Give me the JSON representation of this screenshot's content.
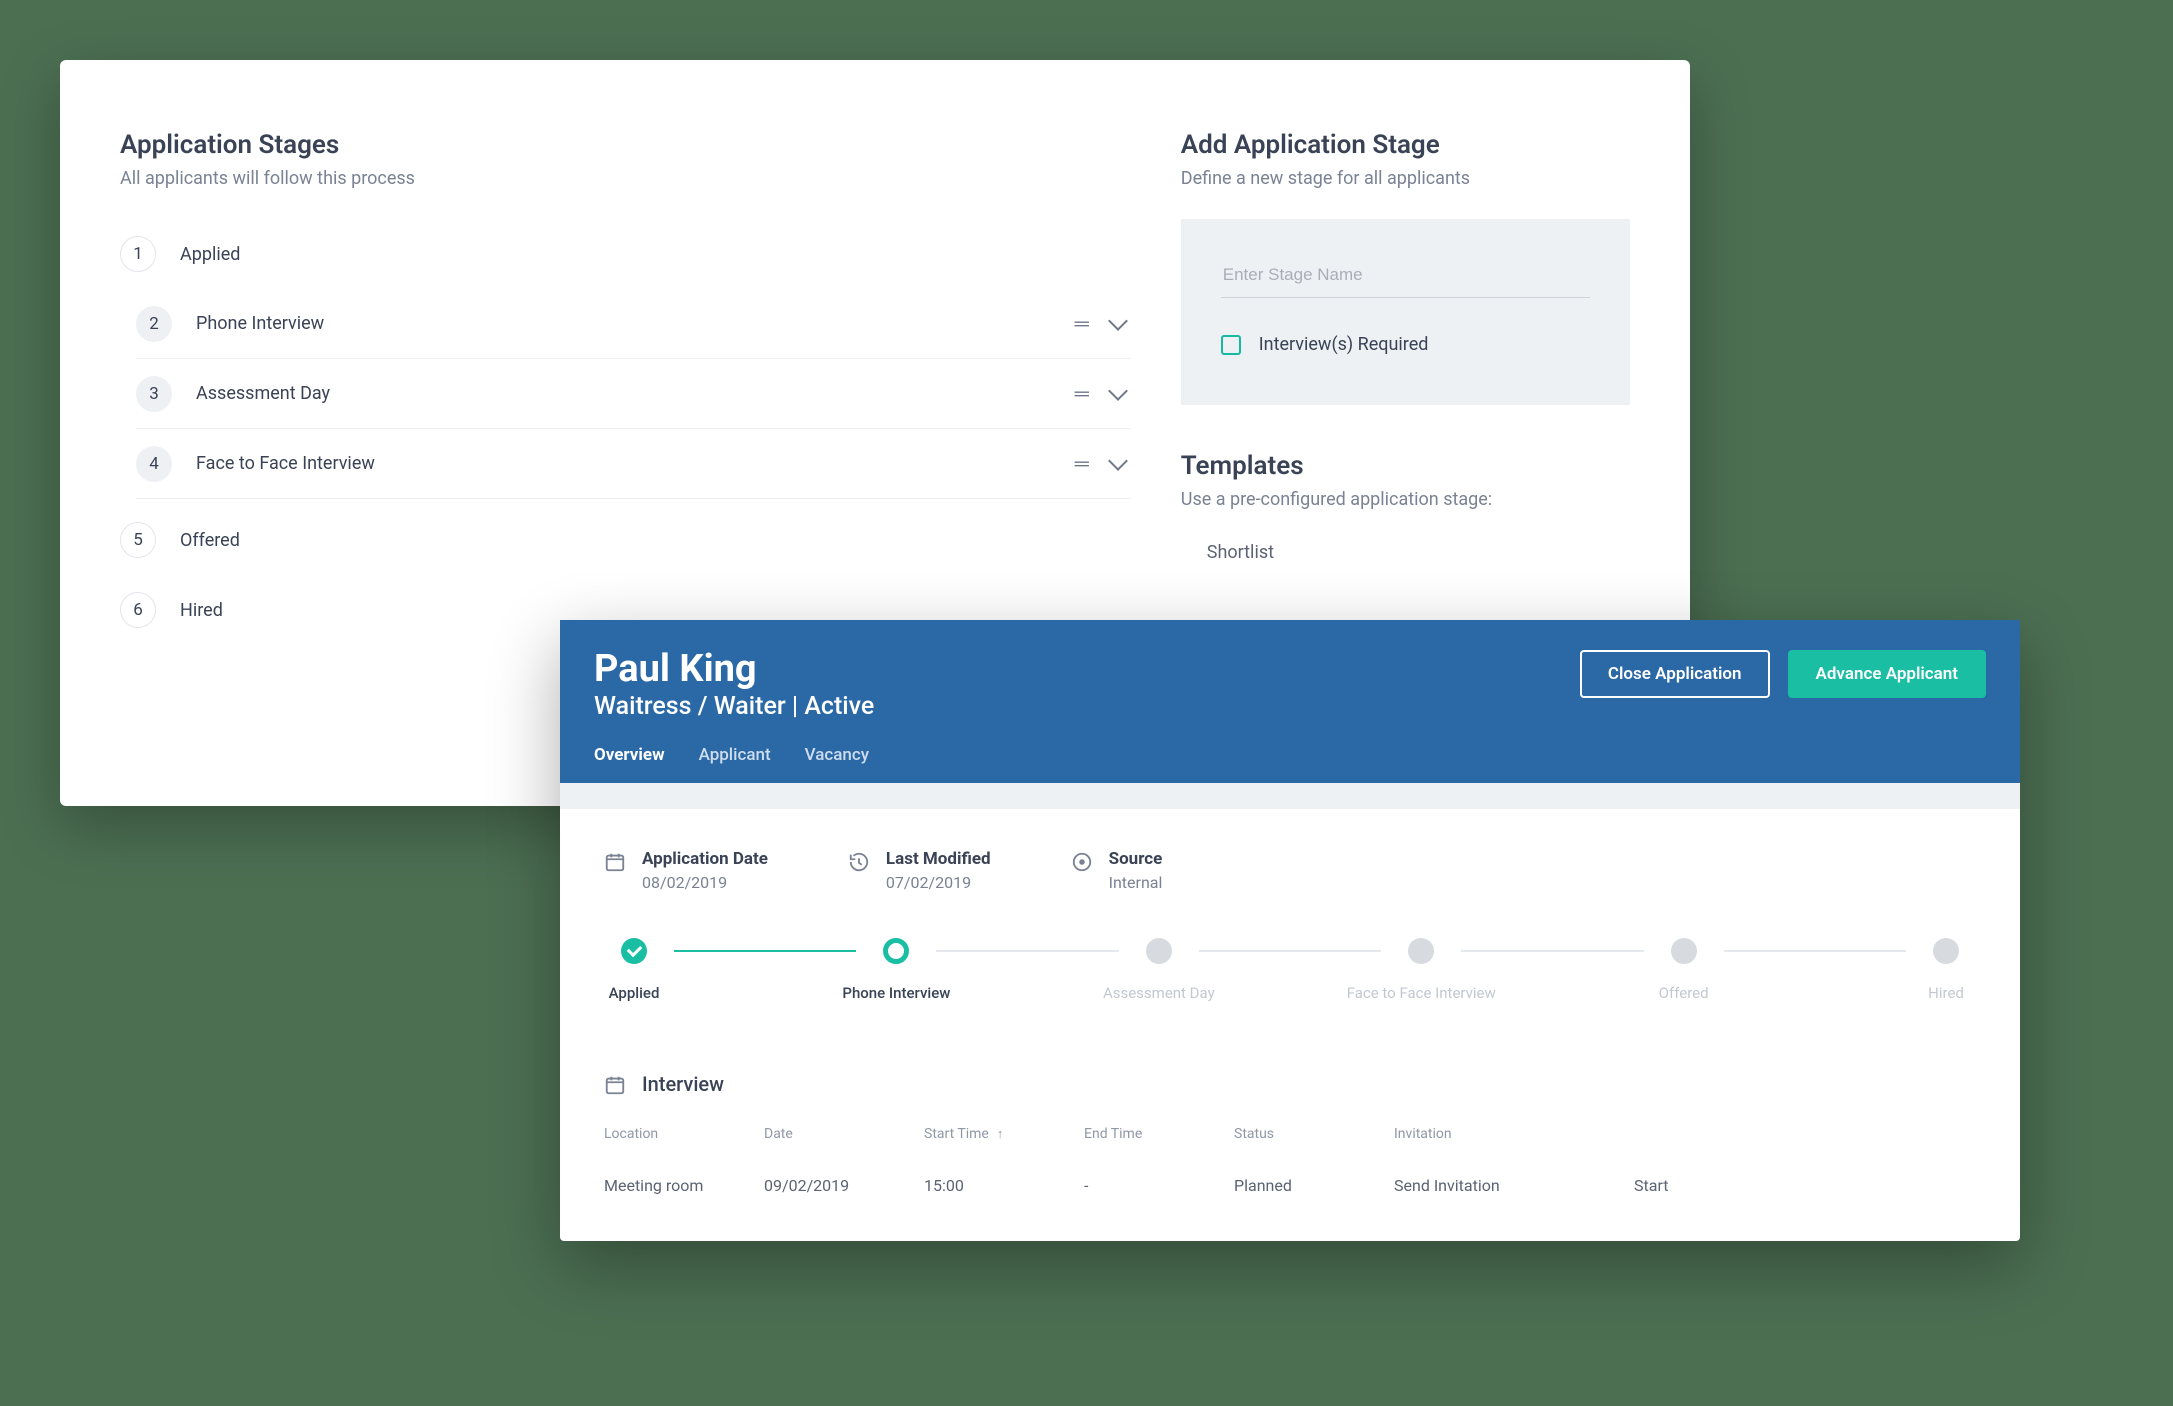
{
  "stagesPanel": {
    "title": "Application Stages",
    "subtitle": "All applicants will follow this process",
    "stages": [
      {
        "num": "1",
        "label": "Applied"
      },
      {
        "num": "2",
        "label": "Phone Interview"
      },
      {
        "num": "3",
        "label": "Assessment Day"
      },
      {
        "num": "4",
        "label": "Face to Face Interview"
      },
      {
        "num": "5",
        "label": "Offered"
      },
      {
        "num": "6",
        "label": "Hired"
      }
    ]
  },
  "addStage": {
    "title": "Add Application Stage",
    "subtitle": "Define a new stage for all applicants",
    "placeholder": "Enter Stage Name",
    "checkboxLabel": "Interview(s) Required"
  },
  "templates": {
    "title": "Templates",
    "subtitle": "Use a pre-configured application stage:",
    "items": [
      "Shortlist"
    ]
  },
  "applicant": {
    "name": "Paul King",
    "role_status": "Waitress / Waiter | Active",
    "closeBtn": "Close Application",
    "advanceBtn": "Advance Applicant",
    "tabs": {
      "overview": "Overview",
      "applicant": "Applicant",
      "vacancy": "Vacancy"
    },
    "meta": {
      "appDateLabel": "Application Date",
      "appDate": "08/02/2019",
      "modLabel": "Last Modified",
      "modDate": "07/02/2019",
      "sourceLabel": "Source",
      "source": "Internal"
    },
    "pipeline": [
      "Applied",
      "Phone Interview",
      "Assessment Day",
      "Face to Face Interview",
      "Offered",
      "Hired"
    ],
    "interview": {
      "title": "Interview",
      "headers": {
        "location": "Location",
        "date": "Date",
        "start": "Start Time",
        "end": "End Time",
        "status": "Status",
        "invitation": "Invitation"
      },
      "row": {
        "location": "Meeting room",
        "date": "09/02/2019",
        "start": "15:00",
        "end": "-",
        "status": "Planned",
        "sendInvitation": "Send Invitation",
        "startAction": "Start"
      }
    }
  }
}
